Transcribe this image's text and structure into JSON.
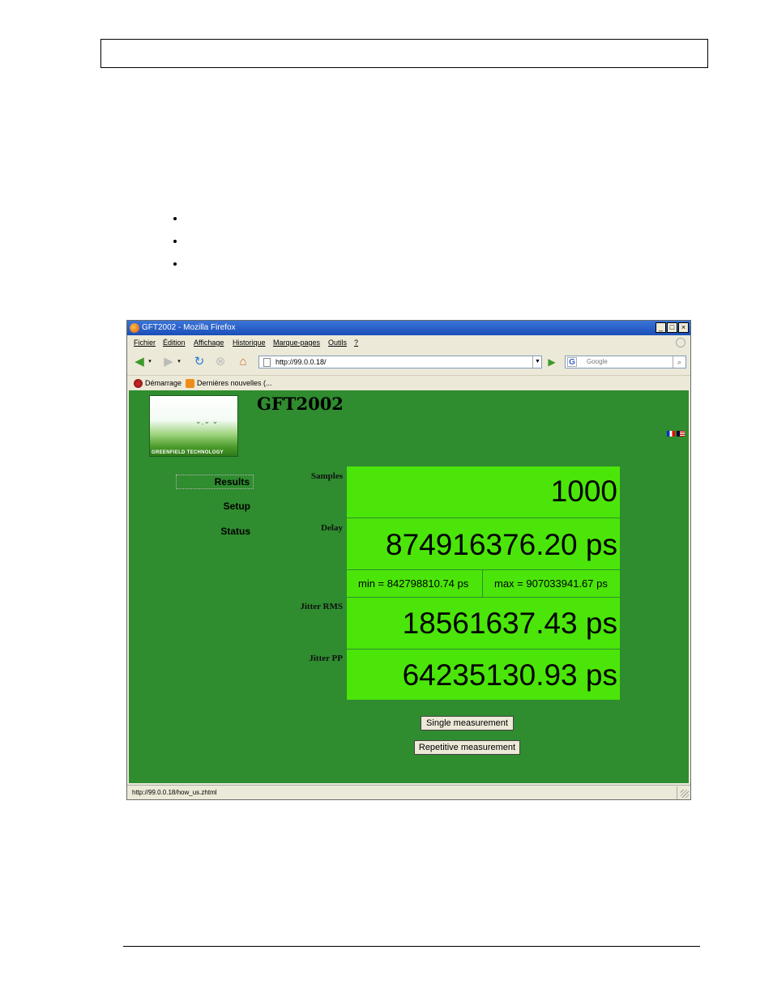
{
  "browser": {
    "window_title": "GFT2002 - Mozilla Firefox",
    "menu": [
      "Fichier",
      "Édition",
      "Affichage",
      "Historique",
      "Marque-pages",
      "Outils",
      "?"
    ],
    "url": "http://99.0.0.18/",
    "search_engine": "G",
    "search_placeholder": "Google",
    "bookmarks": [
      "Démarrage",
      "Dernières nouvelles (..."
    ],
    "status_text": "http://99.0.0.18/how_us.zhtml",
    "window_buttons": [
      "_",
      "□",
      "×"
    ]
  },
  "page": {
    "logo_text": "GREENFIELD TECHNOLOGY",
    "title": "GFT2002",
    "nav": [
      {
        "label": "Results",
        "active": true
      },
      {
        "label": "Setup",
        "active": false
      },
      {
        "label": "Status",
        "active": false
      }
    ],
    "results": {
      "samples_label": "Samples",
      "samples_value": "1000",
      "delay_label": "Delay",
      "delay_value": "874916376.20  ps",
      "delay_min": "min = 842798810.74  ps",
      "delay_max": "max = 907033941.67  ps",
      "jitter_rms_label": "Jitter RMS",
      "jitter_rms_value": "18561637.43  ps",
      "jitter_pp_label": "Jitter PP",
      "jitter_pp_value": "64235130.93  ps"
    },
    "buttons": {
      "single": "Single measurement",
      "repetitive": "Repetitive measurement"
    }
  },
  "colors": {
    "page_bg": "#2f8c2f",
    "cell_bg": "#4be50a",
    "titlebar": "#1b4fb8"
  }
}
